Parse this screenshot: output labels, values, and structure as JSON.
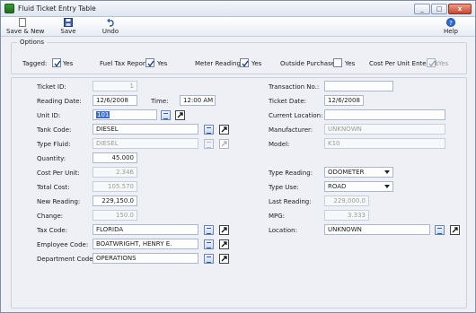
{
  "window": {
    "title": "Fluid Ticket Entry Table"
  },
  "title_buttons": {
    "minimize": "_",
    "maximize": "□",
    "close": "x"
  },
  "toolbar": {
    "save_new": "Save & New",
    "save": "Save",
    "undo": "Undo",
    "help": "Help"
  },
  "options": {
    "title": "Options",
    "tagged": {
      "label": "Tagged:",
      "value": "Yes",
      "checked": true
    },
    "fuel_tax": {
      "label": "Fuel Tax Report:",
      "value": "Yes",
      "checked": true
    },
    "meter_reading": {
      "label": "Meter Reading:",
      "value": "Yes",
      "checked": true
    },
    "outside_purchase": {
      "label": "Outside Purchase:",
      "value": "Yes",
      "checked": false
    },
    "cost_per_unit": {
      "label": "Cost Per Unit Entered:",
      "value": "Yes",
      "checked": true
    }
  },
  "left": {
    "ticket_id": {
      "label": "Ticket ID:",
      "value": "1"
    },
    "reading_date": {
      "label": "Reading Date:",
      "value": "12/6/2008"
    },
    "time": {
      "label": "Time:",
      "value": "12:00 AM"
    },
    "unit_id": {
      "label": "Unit ID:",
      "value": "101"
    },
    "tank_code": {
      "label": "Tank Code:",
      "value": "DIESEL"
    },
    "type_fluid": {
      "label": "Type Fluid:",
      "value": "DIESEL"
    },
    "quantity": {
      "label": "Quantity:",
      "value": "45.000"
    },
    "cost_per_unit": {
      "label": "Cost Per Unit:",
      "value": "2.346"
    },
    "total_cost": {
      "label": "Total Cost:",
      "value": "105.570"
    },
    "new_reading": {
      "label": "New Reading:",
      "value": "229,150.0"
    },
    "change": {
      "label": "Change:",
      "value": "150.0"
    },
    "tax_code": {
      "label": "Tax Code:",
      "value": "FLORIDA"
    },
    "employee_code": {
      "label": "Employee Code:",
      "value": "BOATWRIGHT, HENRY E."
    },
    "department_code": {
      "label": "Department Code:",
      "value": "OPERATIONS"
    }
  },
  "right": {
    "transaction_no": {
      "label": "Transaction No.:",
      "value": ""
    },
    "ticket_date": {
      "label": "Ticket Date:",
      "value": "12/6/2008"
    },
    "current_location": {
      "label": "Current Location:",
      "value": ""
    },
    "manufacturer": {
      "label": "Manufacturer:",
      "value": "UNKNOWN"
    },
    "model": {
      "label": "Model:",
      "value": "K10"
    },
    "type_reading": {
      "label": "Type Reading:",
      "value": "ODOMETER"
    },
    "type_use": {
      "label": "Type Use:",
      "value": "ROAD"
    },
    "last_reading": {
      "label": "Last Reading:",
      "value": "229,000.0"
    },
    "mpg": {
      "label": "MPG:",
      "value": "3.333"
    },
    "location": {
      "label": "Location:",
      "value": "UNKNOWN"
    }
  },
  "colors": {
    "accent": "#3a6fd0",
    "window_bg": "#eef0f5",
    "border": "#a9b8ce"
  }
}
